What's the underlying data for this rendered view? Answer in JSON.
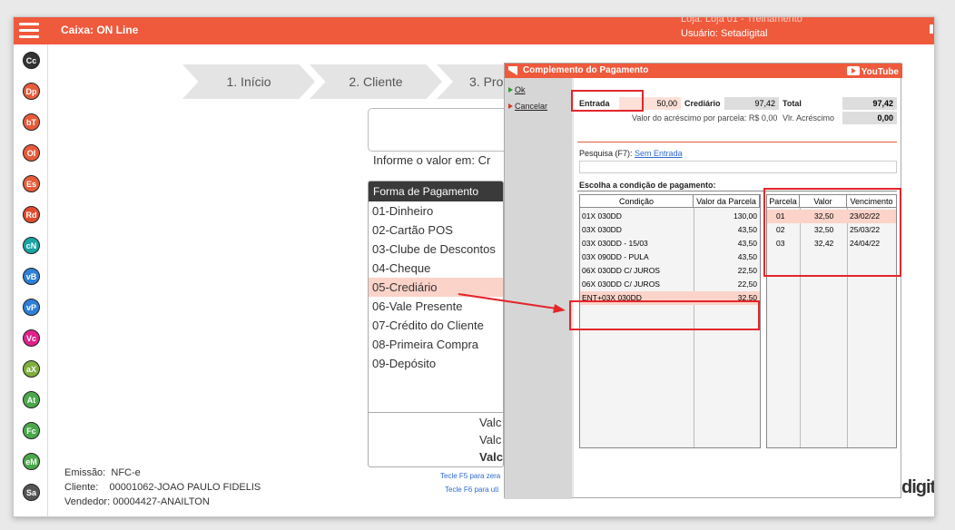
{
  "header": {
    "caixa": "Caixa: ON Line",
    "loja": "Loja: Loja 01 - Treinamento",
    "usuario": "Usuário: Setadigital"
  },
  "sidebar": [
    "Cc",
    "Dp",
    "bT",
    "OI",
    "Es",
    "Rd",
    "cN",
    "vB",
    "vP",
    "Vc",
    "aX",
    "At",
    "Fc",
    "eM",
    "Sa"
  ],
  "sidebar_colors": [
    "#333333",
    "#e85b3a",
    "#e85b3a",
    "#e85b3a",
    "#e85b3a",
    "#e24a2c",
    "#1aa3a3",
    "#2d7fd8",
    "#2d7fd8",
    "#e0208a",
    "#7fae3a",
    "#4aa84a",
    "#4aa84a",
    "#4aa84a",
    "#555555"
  ],
  "steps": [
    "1. Início",
    "2. Cliente",
    "3. Pro"
  ],
  "informe": "Informe o valor em: Cr",
  "forma": {
    "header": "Forma de Pagamento",
    "items": [
      "01-Dinheiro",
      "02-Cartão POS",
      "03-Clube de Descontos",
      "04-Cheque",
      "05-Crediário",
      "06-Vale Presente",
      "07-Crédito do Cliente",
      "08-Primeira Compra",
      "09-Depósito"
    ],
    "selected": 4,
    "valores": [
      "Valc",
      "Valc",
      "Valc"
    ]
  },
  "tecle": [
    "Tecle F5 para zera",
    "Tecle F6 para uti"
  ],
  "footer": {
    "emissao_label": "Emissão:",
    "emissao": "NFC-e",
    "cliente_label": "Cliente:",
    "cliente": "00001062-JOAO PAULO FIDELIS",
    "vendedor": "Vendedor: 00004427-ANAILTON"
  },
  "brand": "digit",
  "dialog": {
    "title": "Complemento do Pagamento",
    "youtube": "YouTube",
    "ok": "Ok",
    "cancelar": "Cancelar",
    "entrada_label": "Entrada",
    "entrada_value": "50,00",
    "crediario_label": "Crediário",
    "crediario_value": "97,42",
    "total_label": "Total",
    "total_value": "97,42",
    "acrescimo_text": "Valor do acréscimo por parcela: R$ 0,00",
    "vlr_acrescimo_label": "Vlr. Acréscimo",
    "vlr_acrescimo_value": "0,00",
    "pesquisa_label": "Pesquisa (F7):",
    "pesquisa_link": "Sem Entrada",
    "escolha_label": "Escolha a condição de pagamento:",
    "cond_headers": [
      "Condição",
      "Valor da Parcela"
    ],
    "conditions": [
      [
        "01X 030DD",
        "130,00"
      ],
      [
        "03X 030DD",
        "43,50"
      ],
      [
        "03X 030DD - 15/03",
        "43,50"
      ],
      [
        "03X 090DD - PULA",
        "43,50"
      ],
      [
        "06X 030DD C/ JUROS",
        "22,50"
      ],
      [
        "06X 030DD C/ JUROS",
        "22,50"
      ],
      [
        "ENT+03X 030DD",
        "32,50"
      ]
    ],
    "selected_condition": 6,
    "parc_headers": [
      "Parcela",
      "Valor",
      "Vencimento"
    ],
    "parcelas": [
      [
        "01",
        "32,50",
        "23/02/22"
      ],
      [
        "02",
        "32,50",
        "25/03/22"
      ],
      [
        "03",
        "32,42",
        "24/04/22"
      ]
    ]
  }
}
